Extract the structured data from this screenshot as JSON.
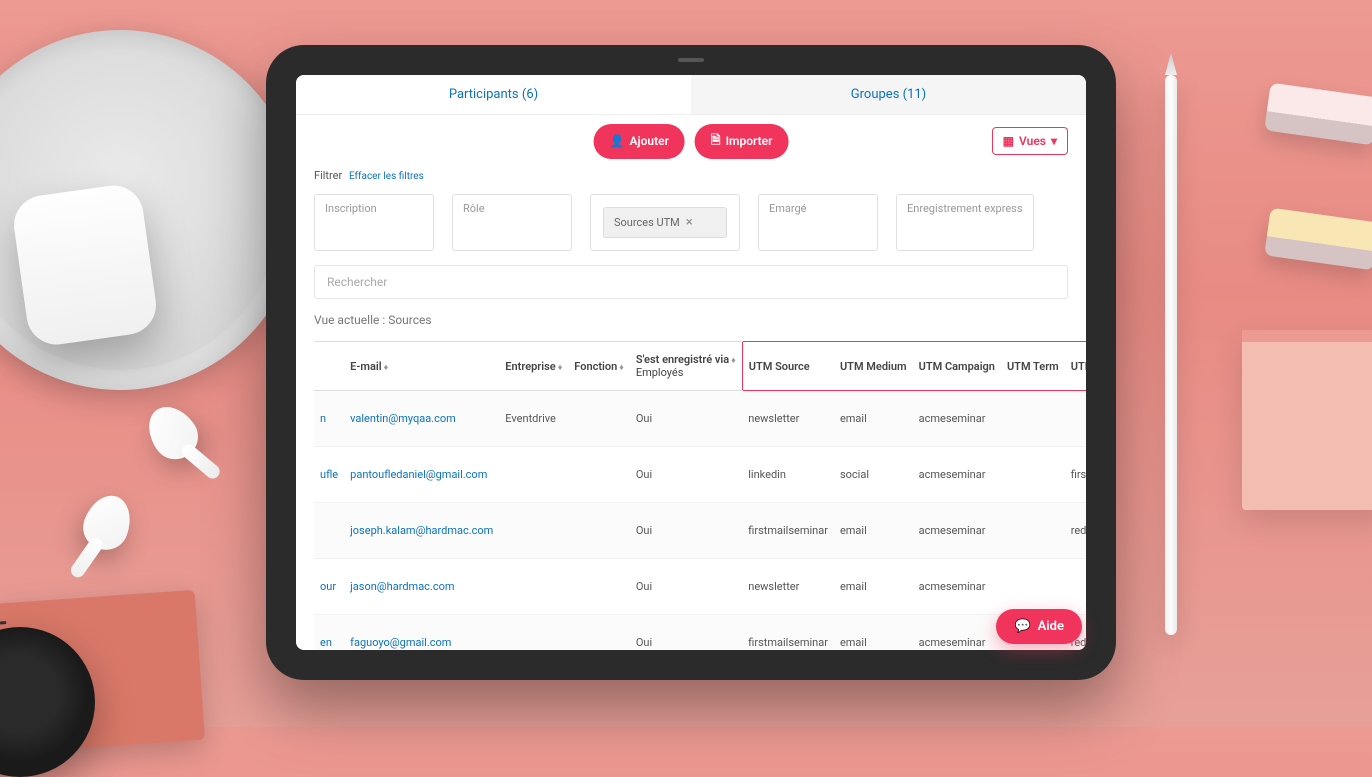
{
  "tabs": {
    "participants": "Participants (6)",
    "groups": "Groupes (11)"
  },
  "toolbar": {
    "add": "Ajouter",
    "import": "Importer",
    "views": "Vues"
  },
  "filter": {
    "label": "Filtrer",
    "clear": "Effacer les filtres"
  },
  "chips": {
    "inscription": "Inscription",
    "role": "Rôle",
    "sources_utm": "Sources UTM",
    "emarge": "Emargé",
    "express": "Enregistrement express"
  },
  "search": {
    "placeholder": "Rechercher"
  },
  "view": {
    "prefix": "Vue actuelle : ",
    "name": "Sources"
  },
  "columns": {
    "email": "E-mail",
    "entreprise": "Entreprise",
    "fonction": "Fonction",
    "registered_via": "S'est enregistré via",
    "registered_sub": "Employés",
    "utm_source": "UTM Source",
    "utm_medium": "UTM Medium",
    "utm_campaign": "UTM Campaign",
    "utm_term": "UTM Term",
    "utm_content": "UTM Content"
  },
  "rows": [
    {
      "prefix": "n",
      "email": "valentin@myqaa.com",
      "entreprise": "Eventdrive",
      "fonction": "",
      "via": "Oui",
      "utm_source": "newsletter",
      "utm_medium": "email",
      "utm_campaign": "acmeseminar",
      "utm_term": "",
      "utm_content": ""
    },
    {
      "prefix": "ufle",
      "email": "pantoufledaniel@gmail.com",
      "entreprise": "",
      "fonction": "",
      "via": "Oui",
      "utm_source": "linkedin",
      "utm_medium": "social",
      "utm_campaign": "acmeseminar",
      "utm_term": "",
      "utm_content": "firstpost"
    },
    {
      "prefix": "",
      "email": "joseph.kalam@hardmac.com",
      "entreprise": "",
      "fonction": "",
      "via": "Oui",
      "utm_source": "firstmailseminar",
      "utm_medium": "email",
      "utm_campaign": "acmeseminar",
      "utm_term": "",
      "utm_content": "redbutton"
    },
    {
      "prefix": "our",
      "email": "jason@hardmac.com",
      "entreprise": "",
      "fonction": "",
      "via": "Oui",
      "utm_source": "newsletter",
      "utm_medium": "email",
      "utm_campaign": "acmeseminar",
      "utm_term": "",
      "utm_content": ""
    },
    {
      "prefix": "en",
      "email": "faguoyo@gmail.com",
      "entreprise": "",
      "fonction": "",
      "via": "Oui",
      "utm_source": "firstmailseminar",
      "utm_medium": "email",
      "utm_campaign": "acmeseminar",
      "utm_term": "",
      "utm_content": "redbutton"
    }
  ],
  "help": "Aide"
}
